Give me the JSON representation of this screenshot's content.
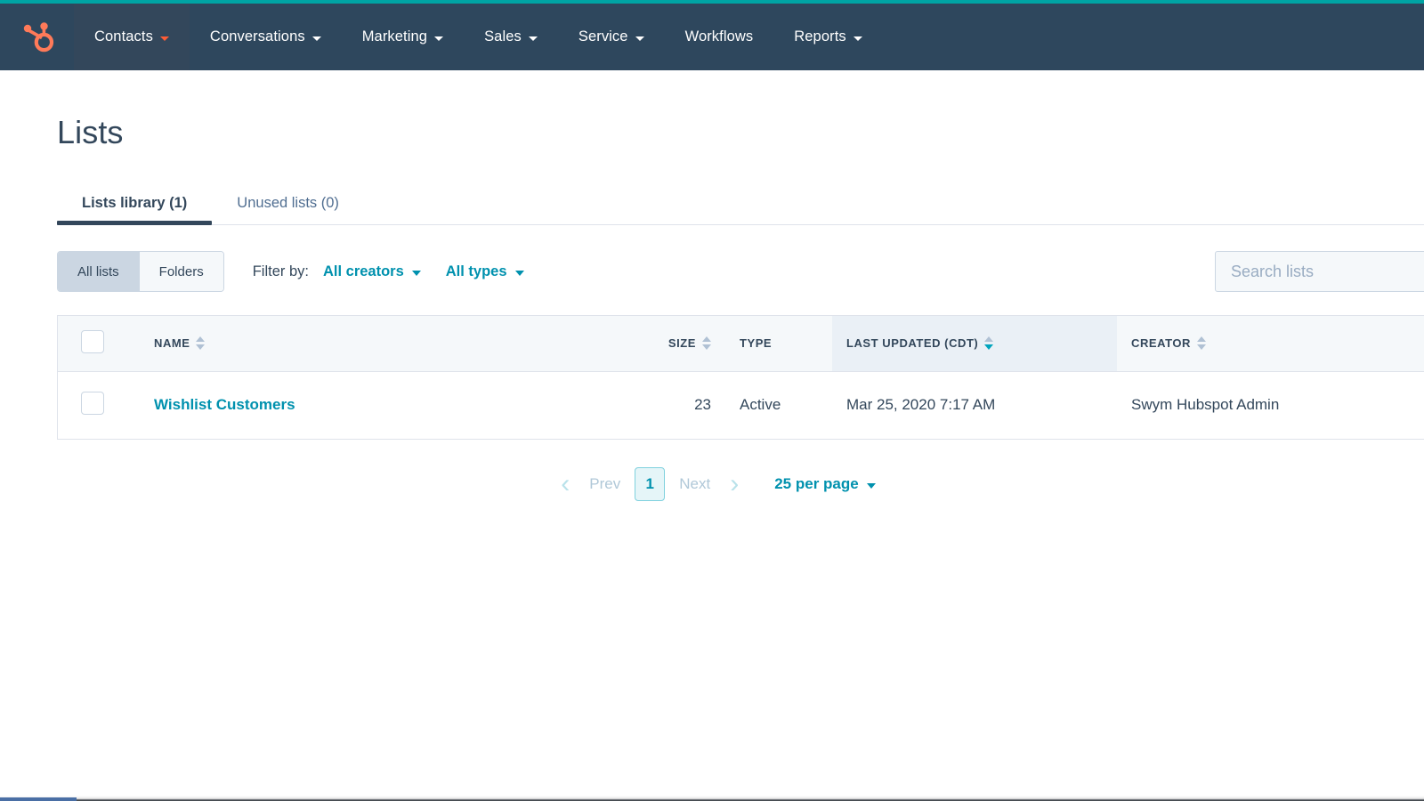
{
  "nav": {
    "logo_icon": "hubspot-sprocket-logo",
    "accent_color": "#00a4a4",
    "background_color": "#2e475d",
    "items": [
      {
        "label": "Contacts",
        "has_caret": true,
        "active": true
      },
      {
        "label": "Conversations",
        "has_caret": true,
        "active": false
      },
      {
        "label": "Marketing",
        "has_caret": true,
        "active": false
      },
      {
        "label": "Sales",
        "has_caret": true,
        "active": false
      },
      {
        "label": "Service",
        "has_caret": true,
        "active": false
      },
      {
        "label": "Workflows",
        "has_caret": false,
        "active": false
      },
      {
        "label": "Reports",
        "has_caret": true,
        "active": false
      }
    ]
  },
  "page": {
    "title": "Lists"
  },
  "tabs": [
    {
      "label": "Lists library (1)",
      "active": true
    },
    {
      "label": "Unused lists (0)",
      "active": false
    }
  ],
  "toolbar": {
    "view_toggle": [
      {
        "label": "All lists",
        "active": true
      },
      {
        "label": "Folders",
        "active": false
      }
    ],
    "filter_label": "Filter by:",
    "filters": [
      {
        "label": "All creators"
      },
      {
        "label": "All types"
      }
    ],
    "search": {
      "placeholder": "Search lists",
      "value": ""
    }
  },
  "table": {
    "columns": [
      {
        "key": "check",
        "label": "",
        "sortable": false,
        "sorted": false
      },
      {
        "key": "name",
        "label": "NAME",
        "sortable": true,
        "sorted": false
      },
      {
        "key": "size",
        "label": "SIZE",
        "sortable": true,
        "sorted": false
      },
      {
        "key": "type",
        "label": "TYPE",
        "sortable": false,
        "sorted": false
      },
      {
        "key": "updated",
        "label": "LAST UPDATED (CDT)",
        "sortable": true,
        "sorted": true,
        "sort_direction": "desc"
      },
      {
        "key": "creator",
        "label": "CREATOR",
        "sortable": true,
        "sorted": false
      }
    ],
    "rows": [
      {
        "name": "Wishlist Customers",
        "size": "23",
        "type": "Active",
        "updated": "Mar 25, 2020 7:17 AM",
        "creator": "Swym Hubspot Admin",
        "selected": false
      }
    ]
  },
  "pagination": {
    "prev_label": "Prev",
    "next_label": "Next",
    "current_page": "1",
    "per_page_label": "25 per page"
  },
  "colors": {
    "nav_background": "#2e475d",
    "nav_accent": "#00a4a4",
    "brand_orange": "#ff5c35",
    "link_teal": "#0091ae",
    "text_navy": "#33475b",
    "table_header_bg": "#f5f8fa",
    "sorted_header_bg": "#eaf0f6"
  }
}
